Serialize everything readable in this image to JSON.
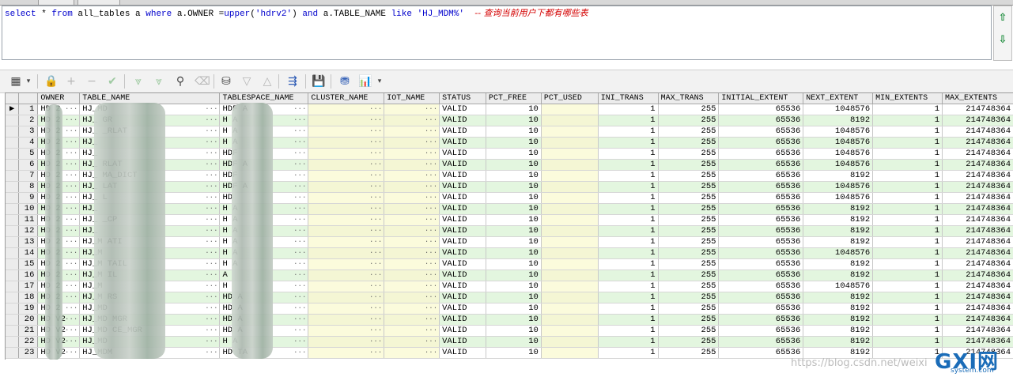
{
  "sql": {
    "tokens": [
      {
        "t": "select",
        "c": "kw"
      },
      {
        "t": " * ",
        "c": "plain"
      },
      {
        "t": "from",
        "c": "kw"
      },
      {
        "t": " all_tables a ",
        "c": "plain"
      },
      {
        "t": "where",
        "c": "kw"
      },
      {
        "t": " a.OWNER =",
        "c": "plain"
      },
      {
        "t": "upper",
        "c": "fn"
      },
      {
        "t": "(",
        "c": "plain"
      },
      {
        "t": "'hdrv2'",
        "c": "str"
      },
      {
        "t": ") ",
        "c": "plain"
      },
      {
        "t": "and",
        "c": "kw"
      },
      {
        "t": " a.TABLE_NAME ",
        "c": "plain"
      },
      {
        "t": "like",
        "c": "kw"
      },
      {
        "t": " ",
        "c": "plain"
      },
      {
        "t": "'HJ_MDM%'",
        "c": "str"
      },
      {
        "t": "  ",
        "c": "plain"
      },
      {
        "t": "-- 查询当前用户下都有哪些表",
        "c": "cmt"
      }
    ]
  },
  "toolbar": {
    "icons": [
      "grid-icon",
      "lock-icon",
      "add-record-icon",
      "delete-record-icon",
      "post-changes-icon",
      "fetch-next-icon",
      "fetch-all-icon",
      "find-icon",
      "clear-icon",
      "query-by-example-icon",
      "filter-icon",
      "sort-icon",
      "explain-plan-icon",
      "save-icon",
      "export-icon",
      "chart-icon"
    ],
    "arrow_up": "⇧",
    "arrow_down": "⇩"
  },
  "grid": {
    "columns": [
      "",
      "",
      "OWNER",
      "TABLE_NAME",
      "TABLESPACE_NAME",
      "CLUSTER_NAME",
      "IOT_NAME",
      "STATUS",
      "PCT_FREE",
      "PCT_USED",
      "INI_TRANS",
      "MAX_TRANS",
      "INITIAL_EXTENT",
      "NEXT_EXTENT",
      "MIN_EXTENTS",
      "MAX_EXTENTS"
    ],
    "rows": [
      {
        "n": "1",
        "owner": "HD  2",
        "table": "HJ_MD",
        "ts": "HDF     A",
        "next": "1048576"
      },
      {
        "n": "2",
        "owner": "HD  2",
        "table": "HJ_           GR",
        "ts": "H         A",
        "next": "8192"
      },
      {
        "n": "3",
        "owner": "HD  2",
        "table": "HJ_           _RLAT",
        "ts": "H         A",
        "next": "1048576"
      },
      {
        "n": "4",
        "owner": "HD  2",
        "table": "HJ_",
        "ts": "H         A",
        "next": "1048576"
      },
      {
        "n": "5",
        "owner": "HD  2",
        "table": "HJ_",
        "ts": "HDF",
        "next": "1048576"
      },
      {
        "n": "6",
        "owner": "HD  2",
        "table": "HJ_           RLAT",
        "ts": "HDF       A",
        "next": "1048576"
      },
      {
        "n": "7",
        "owner": "HD  2",
        "table": "HJ_           MA_DICT",
        "ts": "HDF",
        "next": "8192"
      },
      {
        "n": "8",
        "owner": "HD  2",
        "table": "HJ_           LAT",
        "ts": "HDF       A",
        "next": "1048576"
      },
      {
        "n": "9",
        "owner": "HD  2",
        "table": "HJ_           L",
        "ts": "HD",
        "next": "1048576"
      },
      {
        "n": "10",
        "owner": "HD  2",
        "table": "HJ_",
        "ts": "H         A",
        "next": "8192"
      },
      {
        "n": "11",
        "owner": "HD  2",
        "table": "HJ_           _CP",
        "ts": "H         A",
        "next": "8192"
      },
      {
        "n": "12",
        "owner": "HD  2",
        "table": "HJ_",
        "ts": "H         A",
        "next": "8192"
      },
      {
        "n": "13",
        "owner": "HD  2",
        "table": "HJ_M          ATI",
        "ts": "H         A",
        "next": "8192"
      },
      {
        "n": "14",
        "owner": "HD  2",
        "table": "HJ_M",
        "ts": "H         A",
        "next": "1048576"
      },
      {
        "n": "15",
        "owner": "HD  2",
        "table": "HJ_M          TAIL",
        "ts": "H         A",
        "next": "8192"
      },
      {
        "n": "16",
        "owner": "HD  2",
        "table": "HJ_M          IL",
        "ts": "          A",
        "next": "8192"
      },
      {
        "n": "17",
        "owner": "HD  2",
        "table": "HJ_M",
        "ts": "H",
        "next": "1048576"
      },
      {
        "n": "18",
        "owner": "HD  2",
        "table": "HJ_M          RS",
        "ts": "HD        A",
        "next": "8192"
      },
      {
        "n": "19",
        "owner": "HD  2",
        "table": "HJ_MD",
        "ts": "HD        A",
        "next": "8192"
      },
      {
        "n": "20",
        "owner": "HD V2",
        "table": "HJ_MD         MGR",
        "ts": "HD        A",
        "next": "8192"
      },
      {
        "n": "21",
        "owner": "HD V2",
        "table": "HJ_MD         CE_MGR",
        "ts": "HD        A",
        "next": "8192"
      },
      {
        "n": "22",
        "owner": "HD V2",
        "table": "HJ_MD",
        "ts": "H         A",
        "next": "8192"
      },
      {
        "n": "23",
        "owner": "HD V2",
        "table": "HJ_MDM",
        "ts": "HD       TA",
        "next": "8192"
      }
    ],
    "status": "VALID",
    "pct_free": "10",
    "ini_trans": "1",
    "max_trans": "255",
    "initial_extent": "65536",
    "min_extents": "1",
    "max_extents": "214748364",
    "dots": "···"
  },
  "watermark": "https://blog.csdn.net/weixi",
  "logo": {
    "big": "GXI网",
    "sub": "system.com"
  }
}
